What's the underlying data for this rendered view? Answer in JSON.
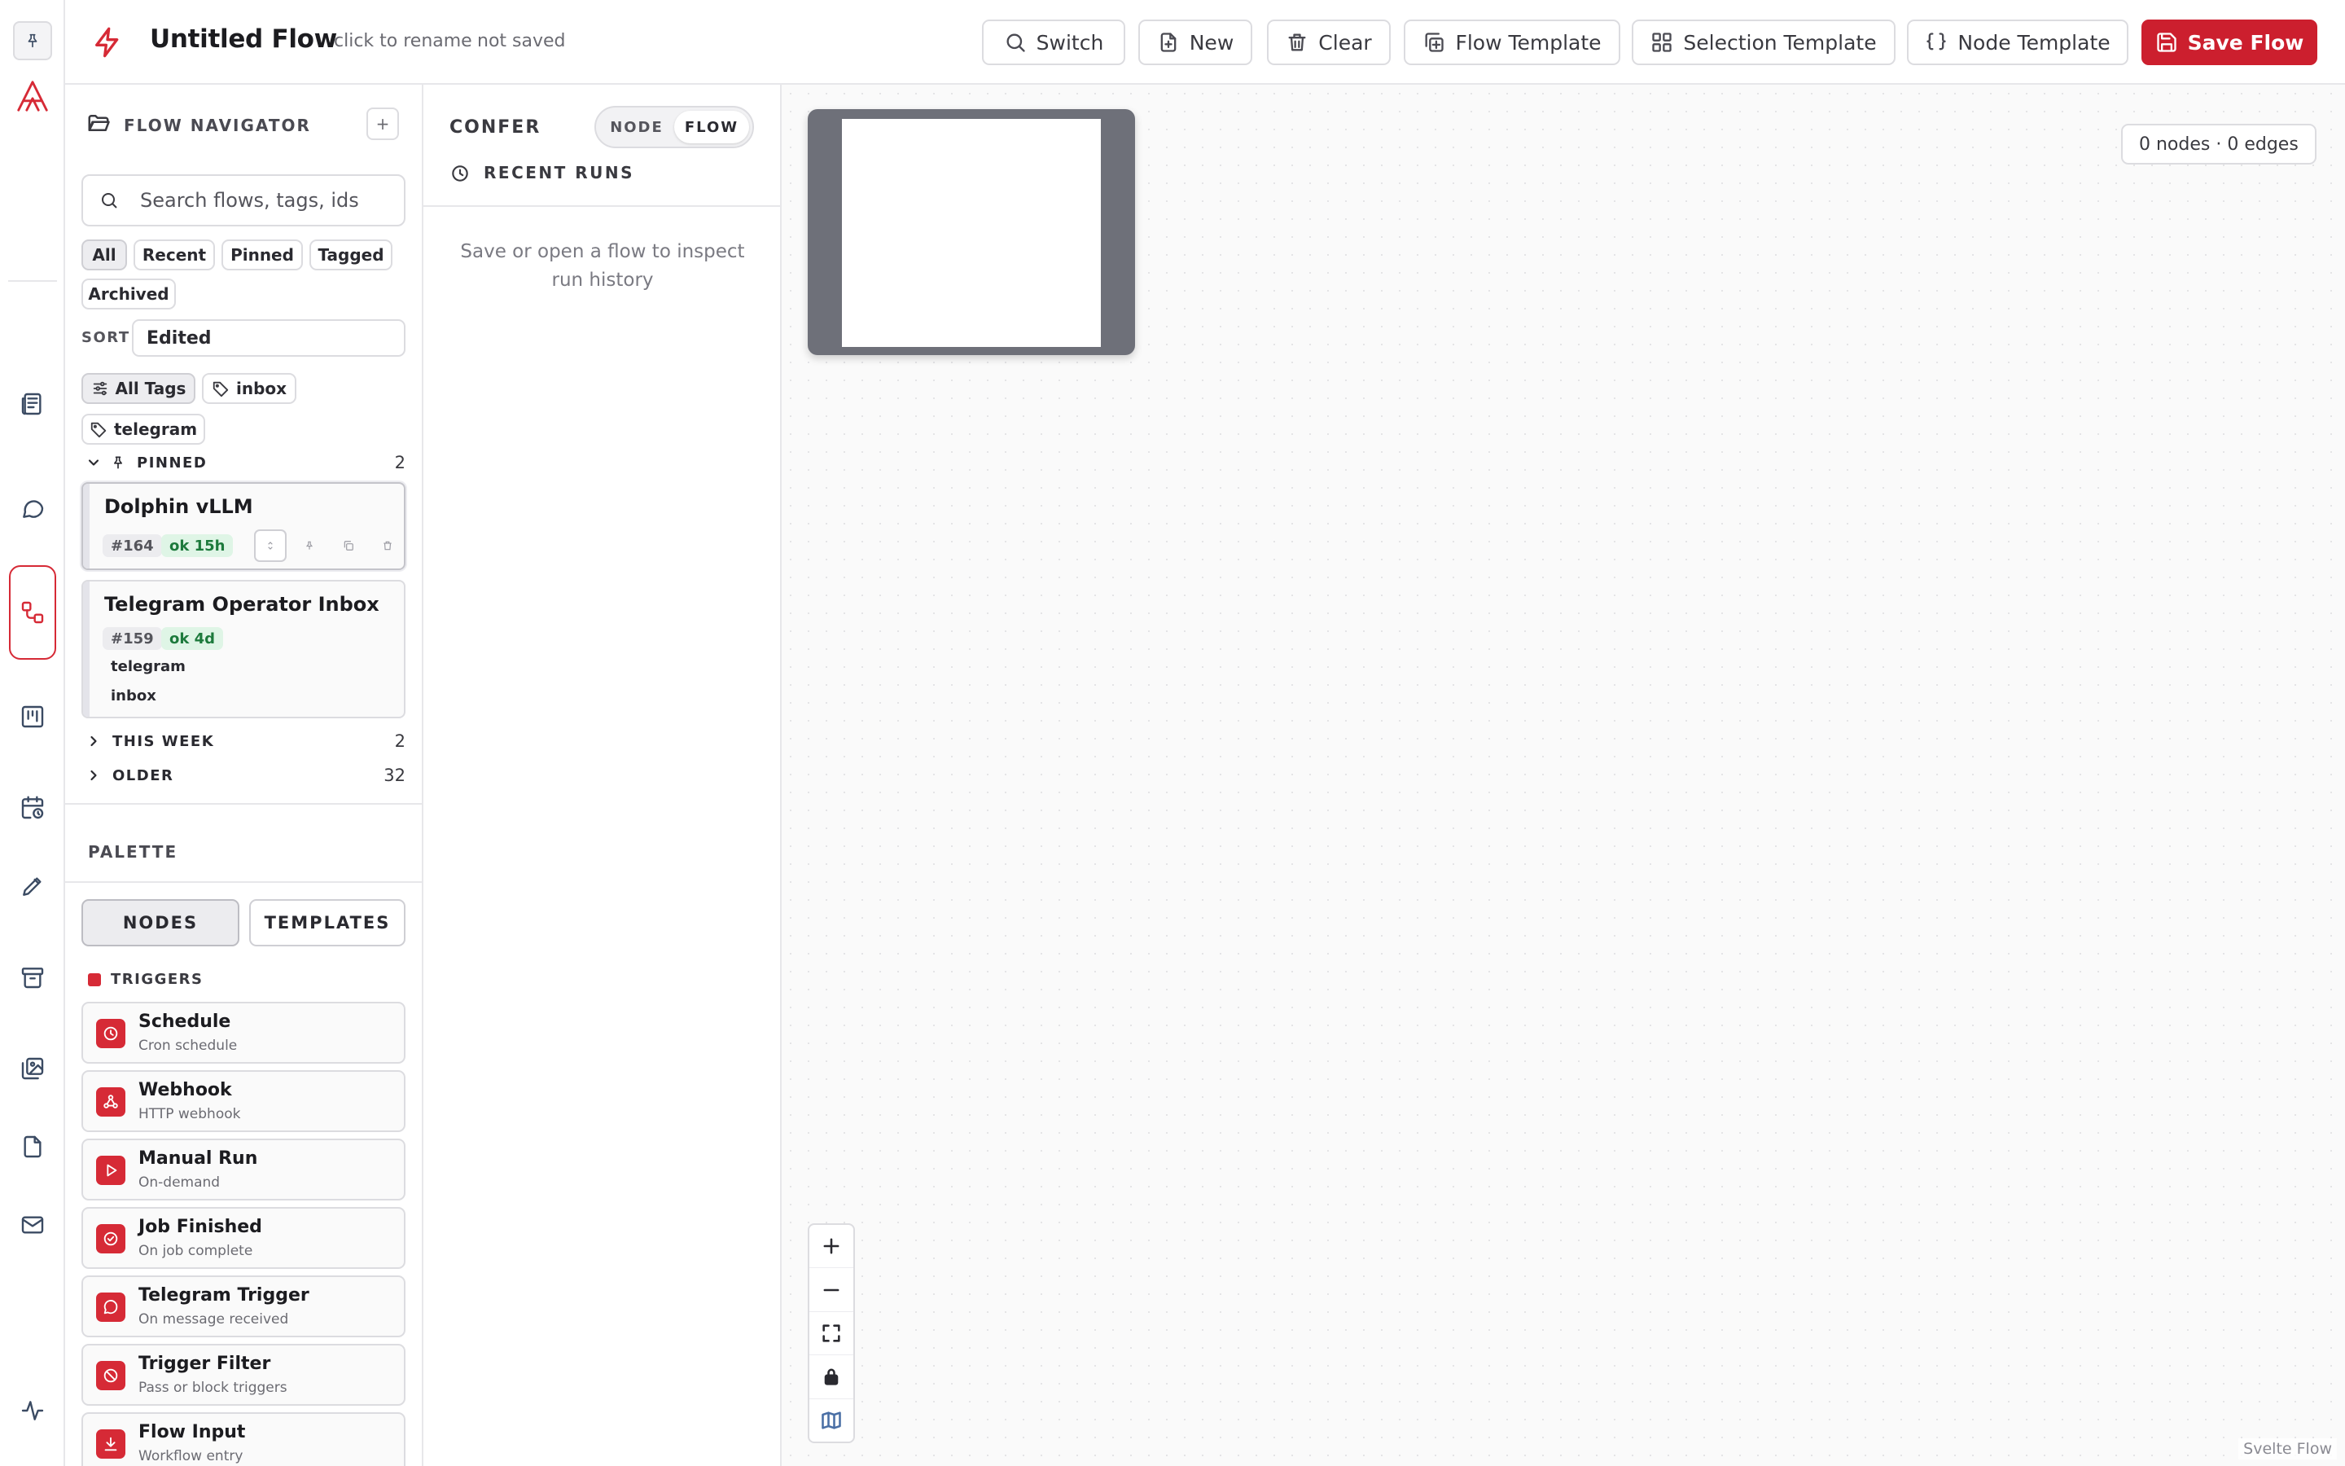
{
  "header": {
    "title": "Untitled Flow",
    "rename_hint": "click to rename",
    "save_status": "not saved",
    "buttons": {
      "switch": "Switch",
      "new": "New",
      "clear": "Clear",
      "flow_template": "Flow Template",
      "selection_template": "Selection Template",
      "node_template": "Node Template",
      "save_flow": "Save Flow"
    }
  },
  "navigator": {
    "title": "FLOW NAVIGATOR",
    "add_label": "+",
    "search_placeholder": "Search flows, tags, ids",
    "filters": [
      "All",
      "Recent",
      "Pinned",
      "Tagged",
      "Archived"
    ],
    "sort_label": "SORT",
    "sort_value": "Edited",
    "tags": [
      "All Tags",
      "inbox",
      "telegram"
    ],
    "groups": {
      "pinned": {
        "label": "PINNED",
        "count": "2"
      },
      "this_week": {
        "label": "THIS WEEK",
        "count": "2"
      },
      "older": {
        "label": "OLDER",
        "count": "32"
      }
    },
    "flows": [
      {
        "name": "Dolphin vLLM",
        "id": "#164",
        "status": "ok 15h",
        "tags": []
      },
      {
        "name": "Telegram Operator Inbox",
        "id": "#159",
        "status": "ok 4d",
        "tags": [
          "telegram",
          "inbox"
        ]
      }
    ]
  },
  "palette": {
    "title": "PALETTE",
    "tabs": [
      "NODES",
      "TEMPLATES"
    ],
    "category": "TRIGGERS",
    "nodes": [
      {
        "name": "Schedule",
        "desc": "Cron schedule",
        "icon": "clock-icon"
      },
      {
        "name": "Webhook",
        "desc": "HTTP webhook",
        "icon": "webhook-icon"
      },
      {
        "name": "Manual Run",
        "desc": "On-demand",
        "icon": "play-icon"
      },
      {
        "name": "Job Finished",
        "desc": "On job complete",
        "icon": "check-circle-icon"
      },
      {
        "name": "Telegram Trigger",
        "desc": "On message received",
        "icon": "message-icon"
      },
      {
        "name": "Trigger Filter",
        "desc": "Pass or block triggers",
        "icon": "ban-icon"
      },
      {
        "name": "Flow Input",
        "desc": "Workflow entry",
        "icon": "download-icon"
      }
    ]
  },
  "confer": {
    "title": "CONFER",
    "modes": [
      "NODE",
      "FLOW"
    ],
    "active_mode": "FLOW",
    "recent_runs_label": "RECENT RUNS",
    "empty_message": "Save or open a flow to inspect run history"
  },
  "canvas": {
    "counts": "0 nodes · 0 edges",
    "attribution": "Svelte Flow"
  },
  "colors": {
    "accent": "#cc1f2e",
    "ok_bg": "#dff5e6",
    "ok_fg": "#1d7a3c"
  }
}
